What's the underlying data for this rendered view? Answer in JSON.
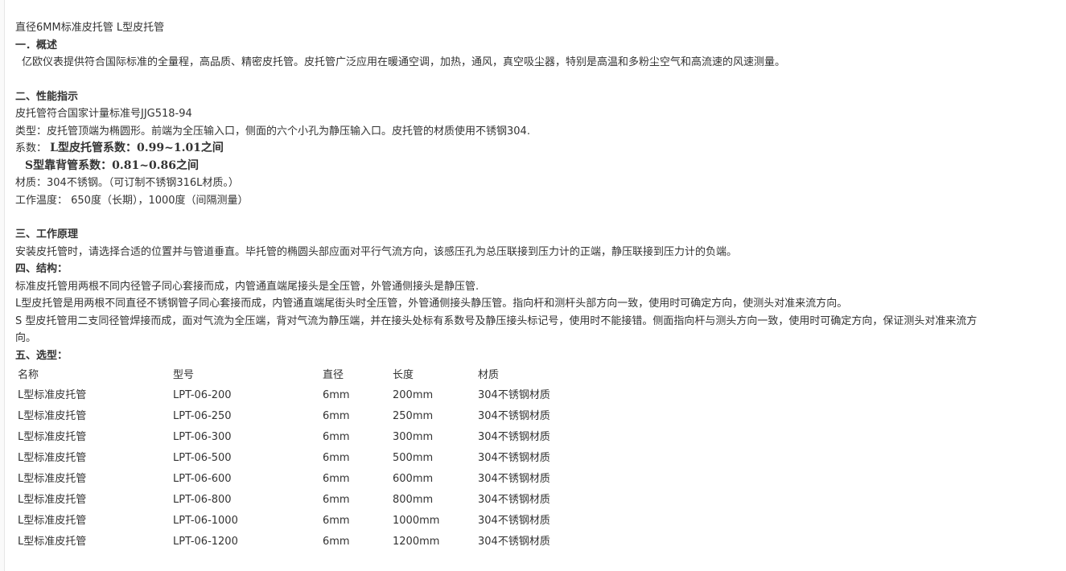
{
  "doc": {
    "title": "直径6MM标准皮托管  L型皮托管",
    "sections": {
      "overview": {
        "heading": "一．概述",
        "text": " 亿欧仪表提供符合国际标准的全量程，高品质、精密皮托管。皮托管广泛应用在暖通空调，加热，通风，真空吸尘器，特别是高温和多粉尘空气和高流速的风速测量。"
      },
      "performance": {
        "heading": "二、性能指示",
        "standard": "皮托管符合国家计量标准号JJG518-94",
        "type": "类型：皮托管顶端为椭圆形。前端为全压输入口，侧面的六个小孔为静压输入口。皮托管的材质使用不锈钢304.",
        "coef_label": "系数：",
        "coef_l": "L型皮托管系数：0.99~1.01之间",
        "coef_s": "S型靠背管系数：0.81~0.86之间",
        "material": "材质：304不锈钢。（可订制不锈钢316L材质。）",
        "temperature": "工作温度： 650度（长期），1000度（间隔测量）"
      },
      "principle": {
        "heading": "三、工作原理",
        "text": "安装皮托管时，请选择合适的位置并与管道垂直。毕托管的椭圆头部应面对平行气流方向，该感压孔为总压联接到压力计的正端，静压联接到压力计的负端。"
      },
      "structure": {
        "heading": "四、结构：",
        "line1": "标准皮托管用两根不同内径管子同心套接而成，内管通直端尾接头是全压管，外管通侧接头是静压管.",
        "line2": "L型皮托管是用两根不同直径不锈钢管子同心套接而成，内管通直端尾街头时全压管，外管通侧接头静压管。指向杆和测杆头部方向一致，使用时可确定方向，使测头对准来流方向。",
        "line3": "S 型皮托管用二支同径管焊接而成，面对气流为全压端，背对气流为静压端，并在接头处标有系数号及静压接头标记号，使用时不能接错。侧面指向杆与测头方向一致，使用时可确定方向，保证测头对准来流方向。"
      },
      "selection": {
        "heading": "五、选型：",
        "columns": [
          "名称",
          "型号",
          "直径",
          "长度",
          "材质"
        ],
        "rows": [
          [
            "L型标准皮托管",
            "LPT-06-200",
            "6mm",
            "200mm",
            "304不锈钢材质"
          ],
          [
            "L型标准皮托管",
            "LPT-06-250",
            "6mm",
            "250mm",
            "304不锈钢材质"
          ],
          [
            "L型标准皮托管",
            "LPT-06-300",
            "6mm",
            "300mm",
            "304不锈钢材质"
          ],
          [
            "L型标准皮托管",
            "LPT-06-500",
            "6mm",
            "500mm",
            "304不锈钢材质"
          ],
          [
            "L型标准皮托管",
            "LPT-06-600",
            "6mm",
            "600mm",
            "304不锈钢材质"
          ],
          [
            "L型标准皮托管",
            "LPT-06-800",
            "6mm",
            "800mm",
            "304不锈钢材质"
          ],
          [
            "L型标准皮托管",
            "LPT-06-1000",
            "6mm",
            "1000mm",
            "304不锈钢材质"
          ],
          [
            "L型标准皮托管",
            "LPT-06-1200",
            "6mm",
            "1200mm",
            "304不锈钢材质"
          ]
        ]
      }
    }
  }
}
